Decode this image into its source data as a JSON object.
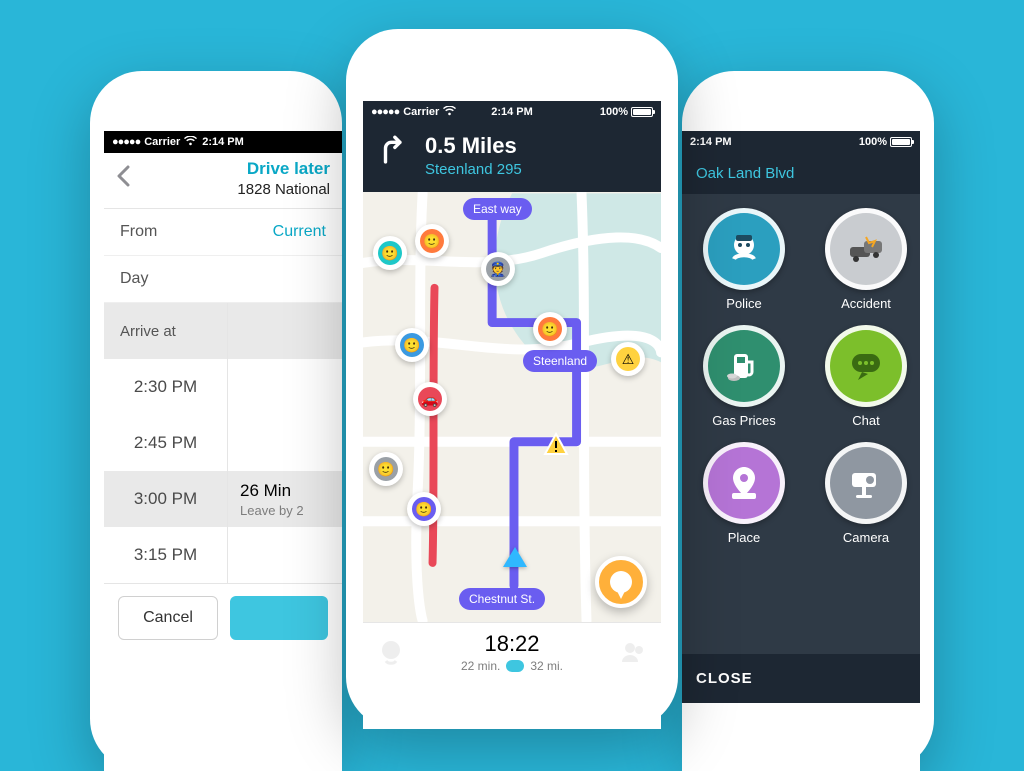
{
  "status": {
    "carrier": "Carrier",
    "signal": "●●●●●",
    "wifi": "⮹",
    "time": "2:14 PM",
    "battery": "100%"
  },
  "left": {
    "title": "Drive later",
    "subtitle": "1828 National",
    "from_label": "From",
    "from_value": "Current",
    "day_label": "Day",
    "arrive_label": "Arrive at",
    "times": [
      "2:30 PM",
      "2:45 PM",
      "3:00 PM",
      "3:15 PM"
    ],
    "selected_index": 2,
    "detail_duration": "26 Min",
    "detail_leave": "Leave by 2",
    "cancel": "Cancel"
  },
  "center": {
    "distance": "0.5 Miles",
    "street": "Steenland 295",
    "labels": {
      "east": "East way",
      "steenland": "Steenland",
      "chestnut": "Chestnut St."
    },
    "eta": "18:22",
    "eta_minutes": "22 min.",
    "eta_miles": "32 mi."
  },
  "right": {
    "street": "Oak Land Blvd",
    "items": [
      {
        "label": "Police",
        "cls": "c-police"
      },
      {
        "label": "Accident",
        "cls": "c-accident"
      },
      {
        "label": "Gas Prices",
        "cls": "c-gas"
      },
      {
        "label": "Chat",
        "cls": "c-chat"
      },
      {
        "label": "Place",
        "cls": "c-place"
      },
      {
        "label": "Camera",
        "cls": "c-camera"
      }
    ],
    "close": "CLOSE"
  }
}
